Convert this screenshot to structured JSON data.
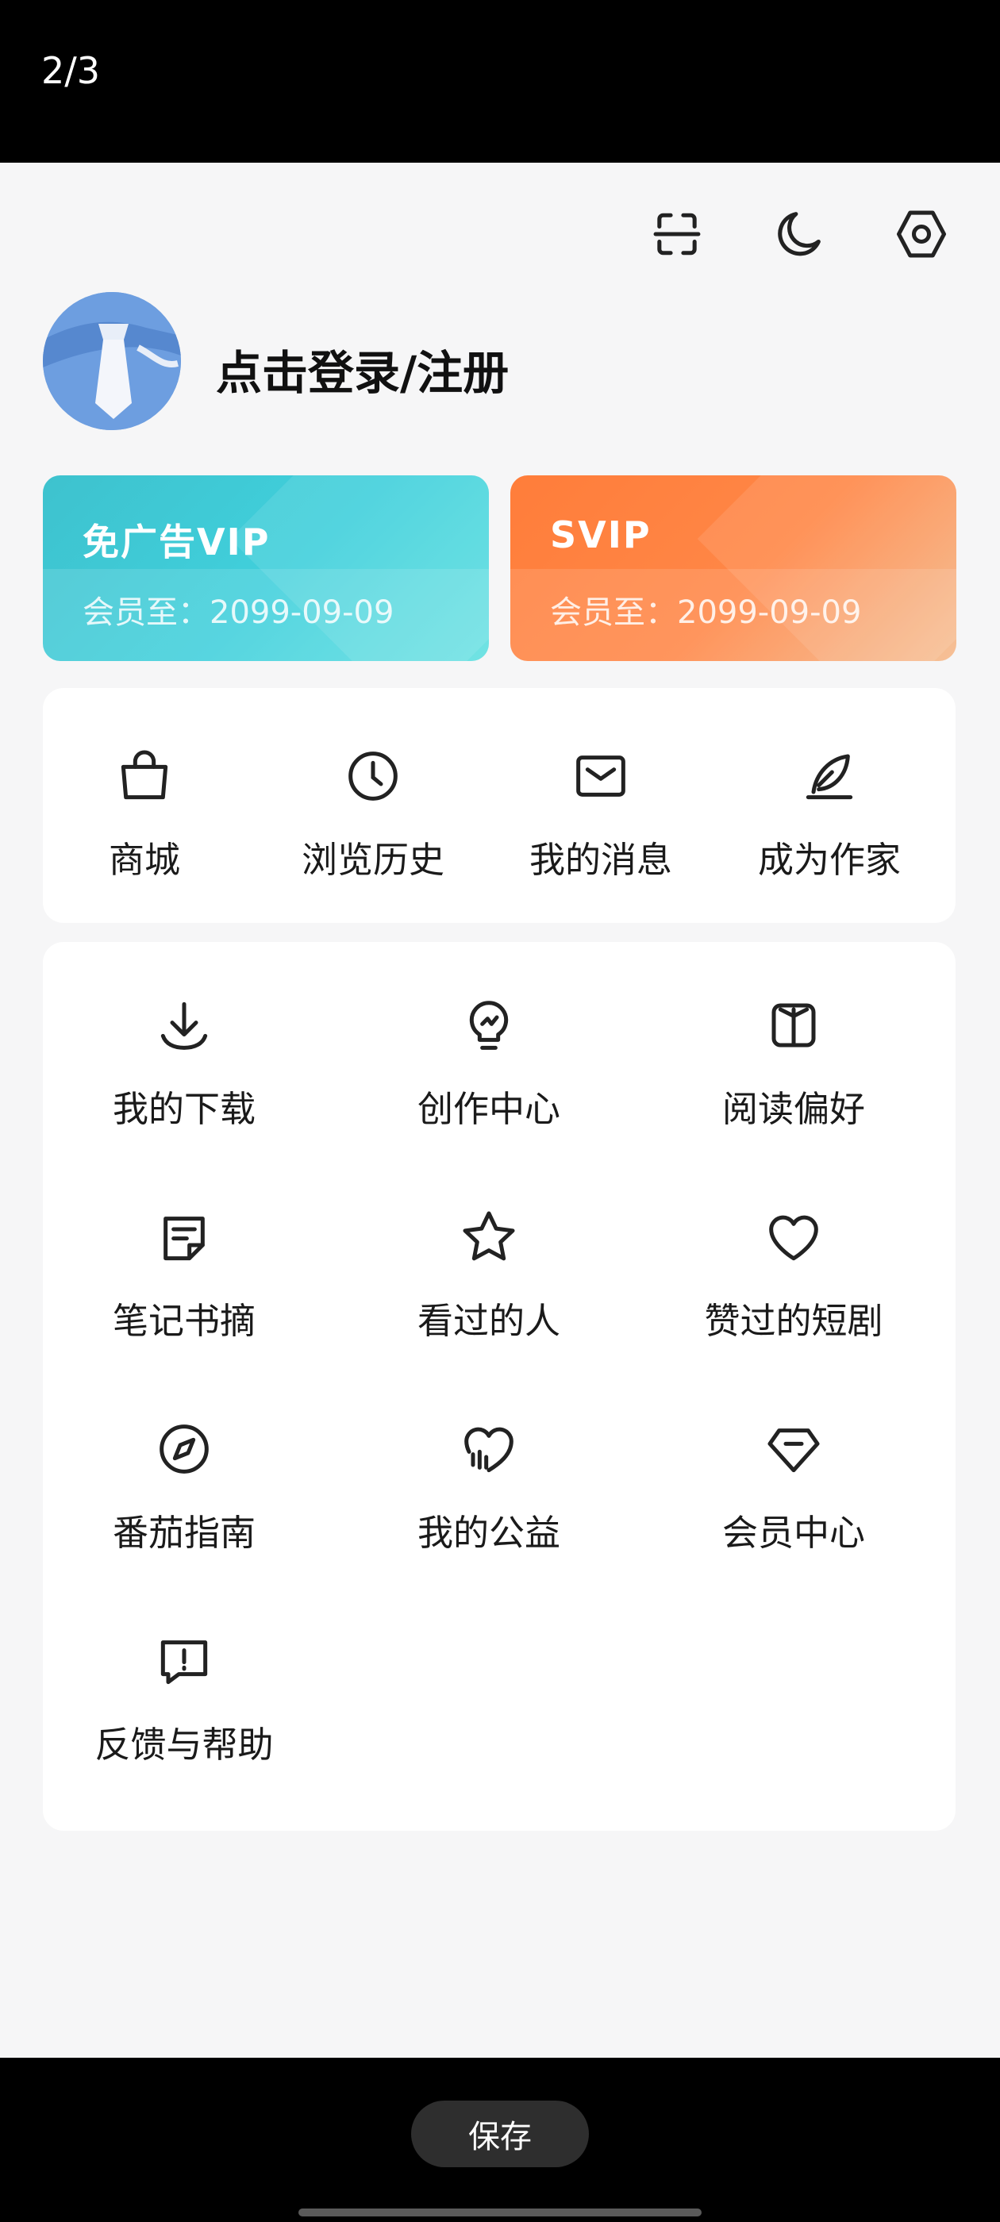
{
  "viewer": {
    "page_counter": "2/3",
    "save_label": "保存"
  },
  "header": {
    "icons": [
      "scan-icon",
      "moon-icon",
      "settings-icon"
    ]
  },
  "profile": {
    "login_text": "点击登录/注册"
  },
  "vip_cards": [
    {
      "title": "免广告VIP",
      "expiry": "会员至：2099-09-09",
      "color": "#40c9d6"
    },
    {
      "title": "SVIP",
      "expiry": "会员至：2099-09-09",
      "color": "#ff8040"
    }
  ],
  "shortcuts": [
    {
      "label": "商城",
      "icon": "bag-icon"
    },
    {
      "label": "浏览历史",
      "icon": "clock-icon"
    },
    {
      "label": "我的消息",
      "icon": "mail-icon"
    },
    {
      "label": "成为作家",
      "icon": "quill-icon"
    }
  ],
  "services": [
    {
      "label": "我的下载",
      "icon": "download-icon"
    },
    {
      "label": "创作中心",
      "icon": "lightbulb-icon"
    },
    {
      "label": "阅读偏好",
      "icon": "book-icon"
    },
    {
      "label": "笔记书摘",
      "icon": "note-icon"
    },
    {
      "label": "看过的人",
      "icon": "star-icon"
    },
    {
      "label": "赞过的短剧",
      "icon": "heart-icon"
    },
    {
      "label": "番茄指南",
      "icon": "compass-icon"
    },
    {
      "label": "我的公益",
      "icon": "charity-heart-icon"
    },
    {
      "label": "会员中心",
      "icon": "diamond-icon"
    },
    {
      "label": "反馈与帮助",
      "icon": "feedback-icon"
    }
  ]
}
